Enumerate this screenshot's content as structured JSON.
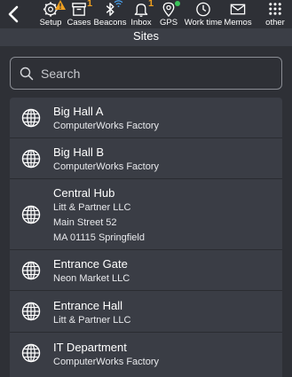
{
  "toolbar": {
    "tools": [
      {
        "label": "Setup",
        "icon": "gear-icon",
        "badge": "!",
        "badge_color": "#f0a020"
      },
      {
        "label": "Cases",
        "icon": "box-icon",
        "badge": "1",
        "badge_color": "#f0a020"
      },
      {
        "label": "Beacons",
        "icon": "bluetooth-icon",
        "badge": ""
      },
      {
        "label": "Inbox",
        "icon": "bell-icon",
        "badge": "1",
        "badge_color": "#f0a020"
      },
      {
        "label": "GPS",
        "icon": "location-pin-icon",
        "badge": "",
        "status_color": "#3cc35a"
      },
      {
        "label": "Work time",
        "icon": "clock-icon",
        "badge": ""
      },
      {
        "label": "Memos",
        "icon": "envelope-icon",
        "badge": ""
      },
      {
        "label": "other",
        "icon": "grid-dots-icon",
        "badge": ""
      }
    ]
  },
  "page": {
    "title": "Sites"
  },
  "search": {
    "placeholder": "Search"
  },
  "sites": [
    {
      "name": "Big Hall A",
      "lines": [
        "ComputerWorks Factory"
      ]
    },
    {
      "name": "Big Hall B",
      "lines": [
        "ComputerWorks Factory"
      ]
    },
    {
      "name": "Central Hub",
      "lines": [
        "Litt & Partner LLC",
        "Main Street 52",
        "MA 01115 Springfield"
      ]
    },
    {
      "name": "Entrance Gate",
      "lines": [
        "Neon Market LLC"
      ]
    },
    {
      "name": "Entrance Hall",
      "lines": [
        "Litt & Partner LLC"
      ]
    },
    {
      "name": "IT Department",
      "lines": [
        "ComputerWorks Factory"
      ]
    }
  ],
  "colors": {
    "background": "#2e3036",
    "list_bg": "#3a3d45",
    "accent_badge": "#f0a020",
    "gps_dot": "#3cc35a"
  }
}
